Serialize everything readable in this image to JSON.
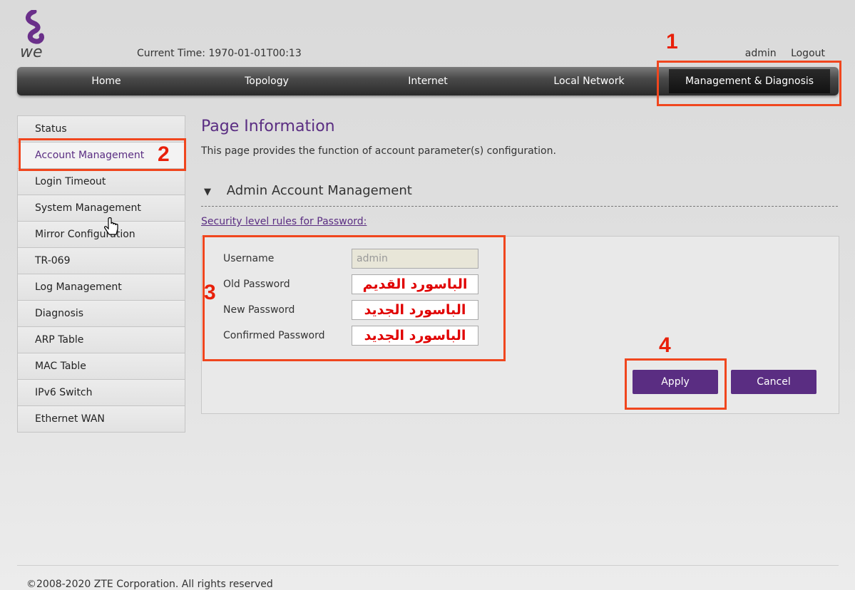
{
  "brand": {
    "logo_text": "we",
    "logo_color": "#5a2d82"
  },
  "header": {
    "current_time_label": "Current Time:",
    "current_time_value": "1970-01-01T00:13",
    "user": "admin",
    "logout": "Logout"
  },
  "nav": {
    "items": [
      {
        "label": "Home"
      },
      {
        "label": "Topology"
      },
      {
        "label": "Internet"
      },
      {
        "label": "Local Network"
      },
      {
        "label": "Management & Diagnosis"
      }
    ],
    "active": "Management & Diagnosis"
  },
  "sidebar": {
    "items": [
      {
        "label": "Status"
      },
      {
        "label": "Account Management"
      },
      {
        "label": "Login Timeout"
      },
      {
        "label": "System Management"
      },
      {
        "label": "Mirror Configuration"
      },
      {
        "label": "TR-069"
      },
      {
        "label": "Log Management"
      },
      {
        "label": "Diagnosis"
      },
      {
        "label": "ARP Table"
      },
      {
        "label": "MAC Table"
      },
      {
        "label": "IPv6 Switch"
      },
      {
        "label": "Ethernet WAN"
      }
    ],
    "active": "Account Management"
  },
  "main": {
    "page_title": "Page Information",
    "page_desc": "This page provides the function of account parameter(s) configuration.",
    "section_title": "Admin Account Management",
    "security_link": "Security level rules for Password:",
    "form": {
      "username_label": "Username",
      "username_value": "admin",
      "old_password_label": "Old Password",
      "old_password_value": "الباسورد القديم",
      "new_password_label": "New Password",
      "new_password_value": "الباسورد الجديد",
      "confirm_password_label": "Confirmed Password",
      "confirm_password_value": "الباسورد الجديد"
    },
    "apply_label": "Apply",
    "cancel_label": "Cancel"
  },
  "annotations": {
    "n1": "1",
    "n2": "2",
    "n3": "3",
    "n4": "4",
    "color": "#f0461e"
  },
  "footer": {
    "copyright": "©2008-2020 ZTE Corporation. All rights reserved"
  },
  "colors": {
    "accent": "#5a2d82",
    "nav_bg": "#2b2b2b"
  }
}
